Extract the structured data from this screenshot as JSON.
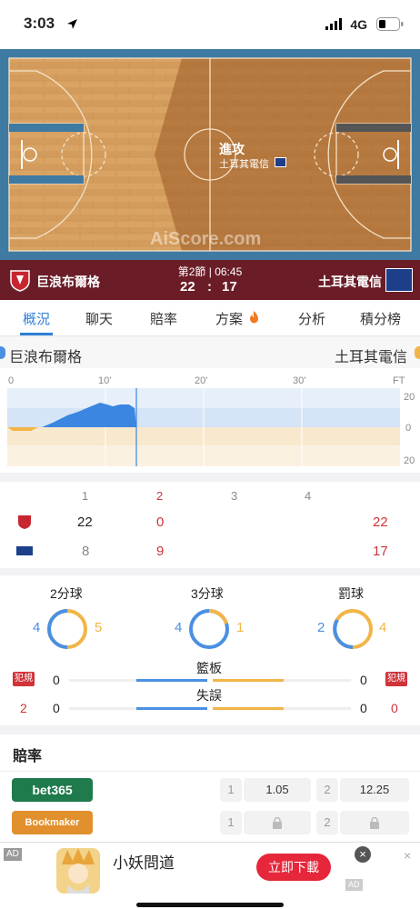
{
  "status": {
    "time": "3:03",
    "network": "4G"
  },
  "court": {
    "attack_label": "進攻",
    "attack_team": "土耳其電信",
    "watermark": "AiScore.com"
  },
  "scorebar": {
    "home": "巨浪布爾格",
    "away": "土耳其電信",
    "period": "第2節 | 06:45",
    "home_score": "22",
    "sep": ":",
    "away_score": "17"
  },
  "tabs": [
    "概況",
    "聊天",
    "賠率",
    "方案",
    "分析",
    "積分榜"
  ],
  "active_tab": 0,
  "team_row": {
    "home": "巨浪布爾格",
    "away": "土耳其電信"
  },
  "momentum": {
    "x_ticks": [
      "0",
      "10'",
      "20'",
      "30'",
      "FT"
    ],
    "y_ticks": [
      "20",
      "0",
      "20"
    ]
  },
  "quarters": {
    "headers": [
      "1",
      "2",
      "3",
      "4"
    ],
    "home": [
      "22",
      "0",
      "",
      ""
    ],
    "home_total": "22",
    "away": [
      "8",
      "9",
      "",
      ""
    ],
    "away_total": "17"
  },
  "stats": {
    "two_pt": {
      "label": "2分球",
      "home": "4",
      "away": "5"
    },
    "three_pt": {
      "label": "3分球",
      "home": "4",
      "away": "1"
    },
    "free_throw": {
      "label": "罰球",
      "home": "2",
      "away": "4"
    },
    "rebounds": {
      "label": "籃板",
      "home": "0",
      "away": "0"
    },
    "turnovers": {
      "label": "失誤",
      "home": "0",
      "away": "0"
    },
    "fouls": {
      "label": "犯規",
      "home": "2",
      "away": "0"
    }
  },
  "odds": {
    "title": "賠率",
    "bet365": {
      "name": "bet365",
      "k1": "1",
      "v1": "1.05",
      "k2": "2",
      "v2": "12.25"
    },
    "bookmaker": {
      "name": "Bookmaker",
      "k1": "1",
      "k2": "2"
    }
  },
  "ad": {
    "badge": "AD",
    "title": "小妖問道",
    "cta": "立即下載",
    "tag": "AD"
  },
  "colors": {
    "home": "#4a90e2",
    "away": "#f2b547",
    "accent": "#2f7fd6",
    "red": "#d0333a",
    "maroon": "#6b1d27"
  }
}
